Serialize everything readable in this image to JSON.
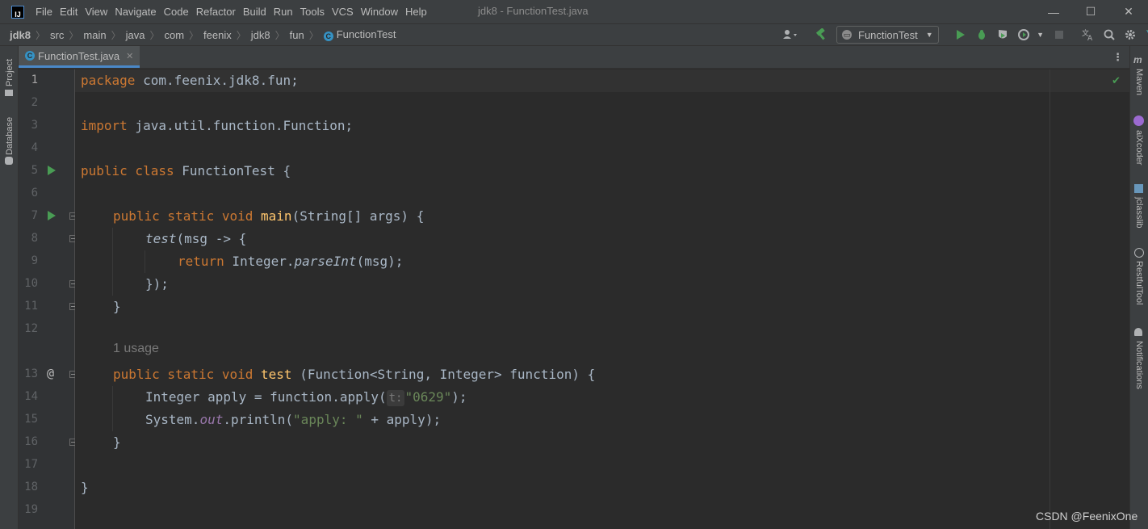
{
  "menubar": {
    "logo": "IJ",
    "items": [
      "File",
      "Edit",
      "View",
      "Navigate",
      "Code",
      "Refactor",
      "Build",
      "Run",
      "Tools",
      "VCS",
      "Window",
      "Help"
    ],
    "title": "jdk8 - FunctionTest.java",
    "controls": {
      "minimize": "—",
      "maximize": "☐",
      "close": "✕"
    }
  },
  "navbar": {
    "breadcrumbs": [
      "jdk8",
      "src",
      "main",
      "java",
      "com",
      "feenix",
      "jdk8",
      "fun",
      "FunctionTest"
    ],
    "run_config": "FunctionTest"
  },
  "left_tool_windows": [
    "Project",
    "Database"
  ],
  "right_tool_windows": [
    "Maven",
    "aiXcoder",
    "jclasslib",
    "RestfulTool",
    "Notifications"
  ],
  "tabs": [
    {
      "label": "FunctionTest.java",
      "active": true
    }
  ],
  "gutter": {
    "line_numbers": [
      "1",
      "2",
      "3",
      "4",
      "5",
      "6",
      "7",
      "8",
      "9",
      "10",
      "11",
      "12",
      "13",
      "14",
      "15",
      "16",
      "17",
      "18",
      "19"
    ]
  },
  "code": {
    "line1": {
      "kw": "package",
      "rest": " com.feenix.jdk8.fun;"
    },
    "line3": {
      "kw": "import",
      "rest": " java.util.function.Function;"
    },
    "line5": {
      "kw": "public class",
      "rest": " FunctionTest {"
    },
    "line7": {
      "kw": "public static void",
      "fn": "main",
      "rest": "(String[] args) {"
    },
    "line8": {
      "it": "test",
      "rest": "(msg -> {"
    },
    "line9": {
      "kw": "return",
      "a": " Integer.",
      "it": "parseInt",
      "b": "(msg);"
    },
    "line10": {
      "text": "});"
    },
    "line11": {
      "text": "}"
    },
    "usage": "1 usage",
    "line13": {
      "kw": "public static void",
      "fn": "test",
      "rest": " (Function<String, Integer> function) {"
    },
    "line14": {
      "a": "Integer apply = function.apply(",
      "hint": "t:",
      "str": "\"0629\"",
      "b": ");"
    },
    "line15": {
      "a": "System.",
      "fld": "out",
      "b": ".println(",
      "str": "\"apply: \"",
      "c": " + apply);"
    },
    "line16": {
      "text": "}"
    },
    "line18": {
      "text": "}"
    }
  },
  "watermark": "CSDN @FeenixOne",
  "colors": {
    "background": "#2b2b2b",
    "keyword": "#cc7832",
    "function": "#ffc66d",
    "string": "#6a8759",
    "field": "#9876aa",
    "run": "#499c54"
  }
}
